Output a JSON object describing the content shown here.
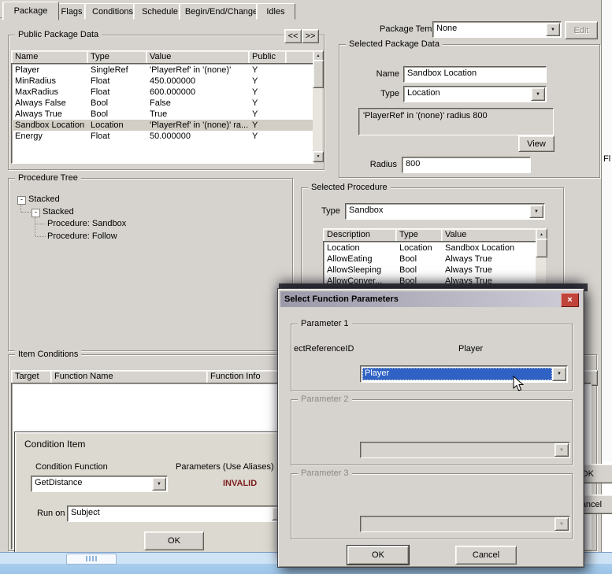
{
  "tabs": {
    "items": [
      "Package",
      "Flags",
      "Conditions",
      "Schedule",
      "Begin/End/Change",
      "Idles"
    ]
  },
  "icons": {
    "down": "▼",
    "up": "▲",
    "minus": "-",
    "close": "×"
  },
  "public_package_data": {
    "title": "Public Package Data",
    "prev_label": "<<",
    "next_label": ">>",
    "headers": {
      "name": "Name",
      "type": "Type",
      "value": "Value",
      "public": "Public"
    },
    "rows": [
      {
        "name": "Player",
        "type": "SingleRef",
        "value": "'PlayerRef' in '(none)'",
        "public": "Y"
      },
      {
        "name": "MinRadius",
        "type": "Float",
        "value": "450.000000",
        "public": "Y"
      },
      {
        "name": "MaxRadius",
        "type": "Float",
        "value": "600.000000",
        "public": "Y"
      },
      {
        "name": "Always False",
        "type": "Bool",
        "value": "False",
        "public": "Y"
      },
      {
        "name": "Always True",
        "type": "Bool",
        "value": "True",
        "public": "Y"
      },
      {
        "name": "Sandbox Location",
        "type": "Location",
        "value": "'PlayerRef' in '(none)' ra...",
        "public": "Y"
      },
      {
        "name": "Energy",
        "type": "Float",
        "value": "50.000000",
        "public": "Y"
      }
    ]
  },
  "package_template": {
    "label": "Package Template",
    "value": "None",
    "edit_label": "Edit"
  },
  "selected_package_data": {
    "title": "Selected Package Data",
    "name_label": "Name",
    "name_value": "Sandbox Location",
    "type_label": "Type",
    "type_value": "Location",
    "preview_text": "'PlayerRef' in '(none)' radius 800",
    "view_label": "View",
    "radius_label": "Radius",
    "radius_value": "800"
  },
  "procedure_tree": {
    "title": "Procedure Tree",
    "root_label": "Stacked",
    "child_label": "Stacked",
    "leaf1_label": "Procedure: Sandbox",
    "leaf2_label": "Procedure: Follow"
  },
  "selected_procedure": {
    "title": "Selected Procedure",
    "type_label": "Type",
    "type_value": "Sandbox",
    "headers": {
      "description": "Description",
      "type": "Type",
      "value": "Value"
    },
    "rows": [
      {
        "description": "Location",
        "type": "Location",
        "value": "Sandbox Location"
      },
      {
        "description": "AllowEating",
        "type": "Bool",
        "value": "Always True"
      },
      {
        "description": "AllowSleeping",
        "type": "Bool",
        "value": "Always True"
      },
      {
        "description": "AllowConver...",
        "type": "Bool",
        "value": "Always True"
      }
    ]
  },
  "item_conditions": {
    "title": "Item Conditions",
    "headers": {
      "target": "Target",
      "function_name": "Function Name",
      "function_info": "Function Info"
    }
  },
  "condition_item": {
    "title": "Condition Item",
    "function_label": "Condition Function",
    "function_value": "GetDistance",
    "parameters_label": "Parameters  (Use Aliases)",
    "parameters_status": "INVALID",
    "run_on_label": "Run on",
    "run_on_value": "Subject",
    "ok_label": "OK"
  },
  "function_params_dialog": {
    "title": "Select Function Parameters",
    "param1": {
      "title": "Parameter 1",
      "field_name": "ectReferenceID",
      "static_value": "Player",
      "dropdown_value": "Player"
    },
    "param2": {
      "title": "Parameter 2"
    },
    "param3": {
      "title": "Parameter 3"
    },
    "ok_label": "OK",
    "cancel_label": "Cancel"
  },
  "background_window": {
    "ok_label": "OK",
    "cancel_label": "Cancel",
    "right_edge_text": "Fl"
  },
  "colors": {
    "selection_blue": "#2f62c4",
    "close_button_red": "#c0443c",
    "window_gray": "#d6d3ce"
  }
}
